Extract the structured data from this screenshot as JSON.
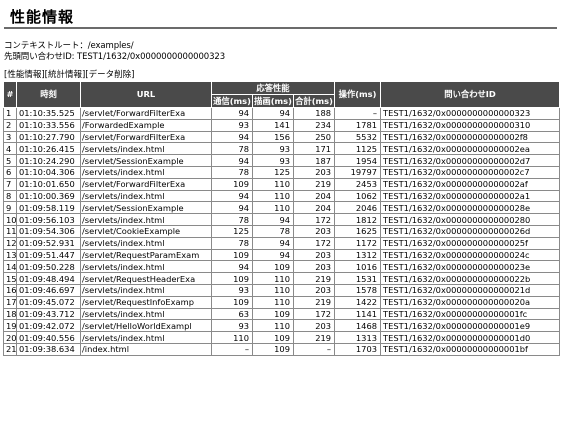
{
  "page": {
    "title": "性能情報",
    "context_root": "コンテキストルート：/examples/",
    "first_query_id": "先頭問い合わせID: TEST1/1632/0x0000000000000323"
  },
  "nav": {
    "perf_info": "[性能情報]",
    "stats_info": "[統計情報]",
    "delete_data": "[データ削除]"
  },
  "table": {
    "headers": {
      "idx": "#",
      "time": "時刻",
      "url": "URL",
      "group": "応答性能",
      "comm": "通信(ms)",
      "draw": "描画(ms)",
      "total": "合計(ms)",
      "op": "操作(ms)",
      "qid": "問い合わせID"
    },
    "rows": [
      [
        "1",
        "01:10:35.525",
        "/servlet/ForwardFilterExa",
        "94",
        "94",
        "188",
        "–",
        "TEST1/1632/0x0000000000000323"
      ],
      [
        "2",
        "01:10:33.556",
        "/ForwardedExample",
        "93",
        "141",
        "234",
        "1781",
        "TEST1/1632/0x0000000000000310"
      ],
      [
        "3",
        "01:10:27.790",
        "/servlet/ForwardFilterExa",
        "94",
        "156",
        "250",
        "5532",
        "TEST1/1632/0x00000000000002f8"
      ],
      [
        "4",
        "01:10:26.415",
        "/servlets/index.html",
        "78",
        "93",
        "171",
        "1125",
        "TEST1/1632/0x00000000000002ea"
      ],
      [
        "5",
        "01:10:24.290",
        "/servlet/SessionExample",
        "94",
        "93",
        "187",
        "1954",
        "TEST1/1632/0x00000000000002d7"
      ],
      [
        "6",
        "01:10:04.306",
        "/servlets/index.html",
        "78",
        "125",
        "203",
        "19797",
        "TEST1/1632/0x00000000000002c7"
      ],
      [
        "7",
        "01:10:01.650",
        "/servlet/ForwardFilterExa",
        "109",
        "110",
        "219",
        "2453",
        "TEST1/1632/0x00000000000002af"
      ],
      [
        "8",
        "01:10:00.369",
        "/servlets/index.html",
        "94",
        "110",
        "204",
        "1062",
        "TEST1/1632/0x00000000000002a1"
      ],
      [
        "9",
        "01:09:58.119",
        "/servlet/SessionExample",
        "94",
        "110",
        "204",
        "2046",
        "TEST1/1632/0x000000000000028e"
      ],
      [
        "10",
        "01:09:56.103",
        "/servlets/index.html",
        "78",
        "94",
        "172",
        "1812",
        "TEST1/1632/0x0000000000000280"
      ],
      [
        "11",
        "01:09:54.306",
        "/servlet/CookieExample",
        "125",
        "78",
        "203",
        "1625",
        "TEST1/1632/0x000000000000026d"
      ],
      [
        "12",
        "01:09:52.931",
        "/servlets/index.html",
        "78",
        "94",
        "172",
        "1172",
        "TEST1/1632/0x000000000000025f"
      ],
      [
        "13",
        "01:09:51.447",
        "/servlet/RequestParamExam",
        "109",
        "94",
        "203",
        "1312",
        "TEST1/1632/0x000000000000024c"
      ],
      [
        "14",
        "01:09:50.228",
        "/servlets/index.html",
        "94",
        "109",
        "203",
        "1016",
        "TEST1/1632/0x000000000000023e"
      ],
      [
        "15",
        "01:09:48.494",
        "/servlet/RequestHeaderExa",
        "109",
        "110",
        "219",
        "1531",
        "TEST1/1632/0x000000000000022b"
      ],
      [
        "16",
        "01:09:46.697",
        "/servlets/index.html",
        "93",
        "110",
        "203",
        "1578",
        "TEST1/1632/0x000000000000021d"
      ],
      [
        "17",
        "01:09:45.072",
        "/servlet/RequestInfoExamp",
        "109",
        "110",
        "219",
        "1422",
        "TEST1/1632/0x000000000000020a"
      ],
      [
        "18",
        "01:09:43.712",
        "/servlets/index.html",
        "63",
        "109",
        "172",
        "1141",
        "TEST1/1632/0x00000000000001fc"
      ],
      [
        "19",
        "01:09:42.072",
        "/servlet/HelloWorldExampl",
        "93",
        "110",
        "203",
        "1468",
        "TEST1/1632/0x00000000000001e9"
      ],
      [
        "20",
        "01:09:40.556",
        "/servlets/index.html",
        "110",
        "109",
        "219",
        "1313",
        "TEST1/1632/0x00000000000001d0"
      ],
      [
        "21",
        "01:09:38.634",
        "/index.html",
        "–",
        "109",
        "–",
        "1703",
        "TEST1/1632/0x00000000000001bf"
      ]
    ]
  }
}
